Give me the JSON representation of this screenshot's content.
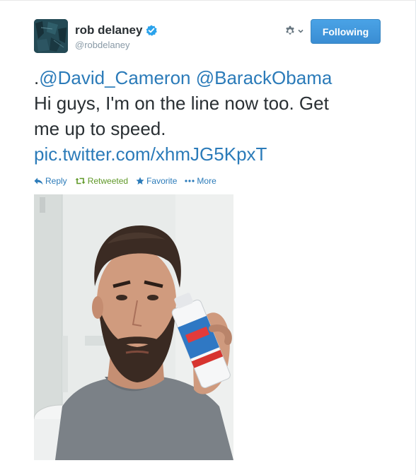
{
  "profile": {
    "fullname": "rob delaney",
    "username": "@robdelaney",
    "verified_icon": "verified-badge-icon"
  },
  "header": {
    "settings_icon": "gear-icon",
    "dropdown_icon": "chevron-down-icon",
    "follow_label": "Following"
  },
  "tweet": {
    "prefix": ".",
    "mention1": "@David_Cameron",
    "mention2": "@BarackObama",
    "line1": "Hi guys, I'm on the line now too. Get",
    "line2": "me up to speed.",
    "media_link": "pic.twitter.com/xhmJG5KpxT"
  },
  "actions": {
    "reply": "Reply",
    "retweet": "Retweeted",
    "favorite": "Favorite",
    "more": "More"
  },
  "colors": {
    "link": "#2b7bb9",
    "retweeted": "#609928",
    "follow_button": "#3b94d9"
  }
}
